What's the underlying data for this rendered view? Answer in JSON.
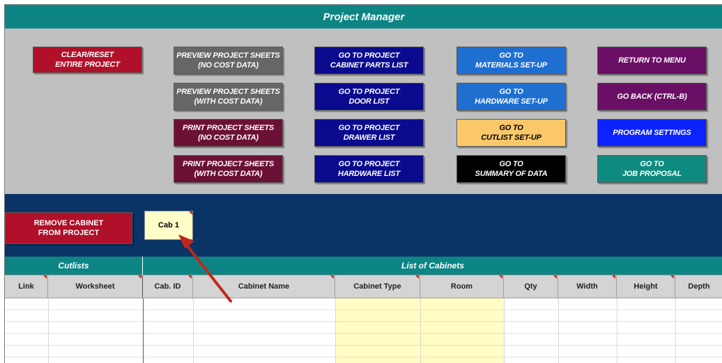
{
  "header": {
    "title": "Project Manager"
  },
  "buttons": {
    "clear_reset": "CLEAR/RESET\nENTIRE PROJECT",
    "preview_no_cost": "PREVIEW PROJECT SHEETS\n(NO COST DATA)",
    "preview_with_cost": "PREVIEW PROJECT SHEETS\n(WITH COST DATA)",
    "print_no_cost": "PRINT PROJECT SHEETS\n(NO COST DATA)",
    "print_with_cost": "PRINT PROJECT SHEETS\n(WITH COST DATA)",
    "goto_parts_list": "GO TO PROJECT\nCABINET PARTS LIST",
    "goto_door_list": "GO TO PROJECT\nDOOR LIST",
    "goto_drawer_list": "GO TO PROJECT\nDRAWER LIST",
    "goto_hardware_list": "GO TO PROJECT\nHARDWARE LIST",
    "goto_materials": "GO TO\nMATERIALS SET-UP",
    "goto_hardware_setup": "GO TO\nHARDWARE SET-UP",
    "goto_cutlist": "GO TO\nCUTLIST SET-UP",
    "goto_summary": "GO TO\nSUMMARY OF DATA",
    "return_menu": "RETURN TO MENU",
    "go_back": "GO BACK  (CTRL-B)",
    "program_settings": "PROGRAM SETTINGS",
    "job_proposal": "GO  TO\nJOB PROPOSAL"
  },
  "cabinet_strip": {
    "remove_label": "REMOVE CABINET\nFROM PROJECT",
    "tabs": [
      "Cab 1"
    ]
  },
  "sections": {
    "cutlists": "Cutlists",
    "list_of_cabinets": "List of Cabinets"
  },
  "columns": {
    "link": "Link",
    "worksheet": "Worksheet",
    "cab_id": "Cab. ID",
    "cabinet_name": "Cabinet Name",
    "cabinet_type": "Cabinet Type",
    "room": "Room",
    "qty": "Qty",
    "width": "Width",
    "height": "Height",
    "depth": "Depth"
  },
  "colors": {
    "title_bar": "#0e8585",
    "panel": "#c0c0c0",
    "cabinet_strip": "#0a3366",
    "arrow": "#c0271c"
  },
  "icons": {
    "annotation": "arrow-pointer-icon"
  }
}
